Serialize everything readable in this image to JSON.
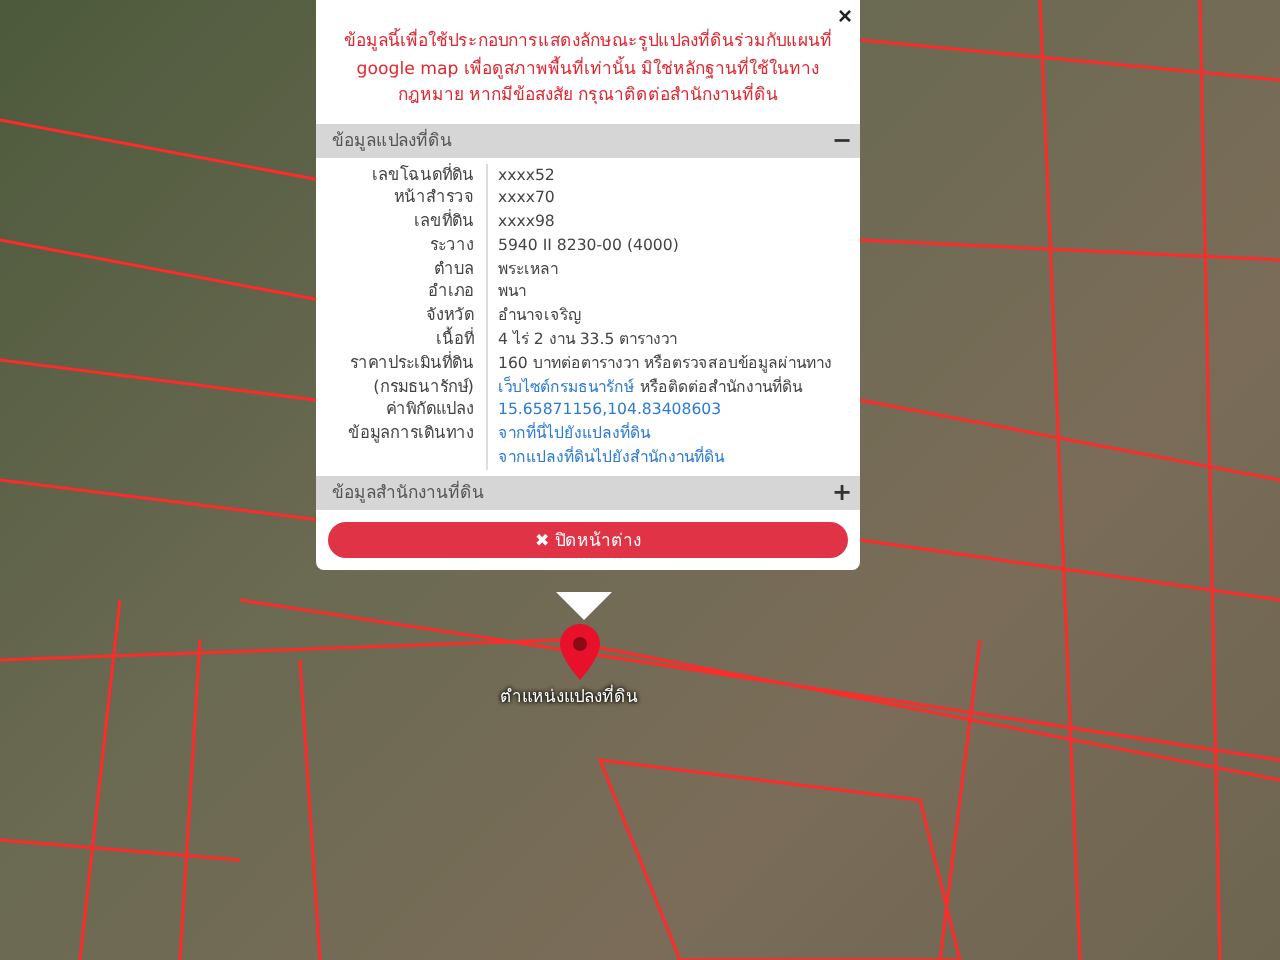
{
  "popup": {
    "notice": "ข้อมูลนี้เพื่อใช้ประกอบการแสดงลักษณะรูปแปลงที่ดินร่วมกับแผนที่ google map เพื่อดูสภาพพื้นที่เท่านั้น มิใช่หลักฐานที่ใช้ในทางกฎหมาย หากมีข้อสงสัย กรุณาติดต่อสำนักงานที่ดิน",
    "close_icon": "×",
    "sections": [
      {
        "title": "ข้อมูลแปลงที่ดิน",
        "toggle": "−",
        "rows": [
          {
            "label": [
              "เลขโฉนดที่ดิน"
            ],
            "lines": [
              [
                {
                  "kind": "text",
                  "text": "xxxx52"
                }
              ]
            ]
          },
          {
            "label": [
              "หน้าสำรวจ"
            ],
            "lines": [
              [
                {
                  "kind": "text",
                  "text": "xxxx70"
                }
              ]
            ]
          },
          {
            "label": [
              "เลขที่ดิน"
            ],
            "lines": [
              [
                {
                  "kind": "text",
                  "text": "xxxx98"
                }
              ]
            ]
          },
          {
            "label": [
              "ระวาง"
            ],
            "lines": [
              [
                {
                  "kind": "text",
                  "text": "5940 II 8230-00 (4000)"
                }
              ]
            ]
          },
          {
            "label": [
              "ตำบล"
            ],
            "lines": [
              [
                {
                  "kind": "text",
                  "text": "พระเหลา"
                }
              ]
            ]
          },
          {
            "label": [
              "อำเภอ"
            ],
            "lines": [
              [
                {
                  "kind": "text",
                  "text": "พนา"
                }
              ]
            ]
          },
          {
            "label": [
              "จังหวัด"
            ],
            "lines": [
              [
                {
                  "kind": "text",
                  "text": "อำนาจเจริญ"
                }
              ]
            ]
          },
          {
            "label": [
              "เนื้อที่"
            ],
            "lines": [
              [
                {
                  "kind": "text",
                  "text": "4 ไร่ 2 งาน 33.5 ตารางวา"
                }
              ]
            ]
          },
          {
            "label": [
              "ราคาประเมินที่ดิน",
              "(กรมธนารักษ์)"
            ],
            "lines": [
              [
                {
                  "kind": "text",
                  "text": "160 บาทต่อตารางวา หรือตรวจสอบข้อมูลผ่านทาง"
                }
              ],
              [
                {
                  "kind": "link",
                  "text": "เว็บไซต์กรมธนารักษ์"
                },
                {
                  "kind": "text",
                  "text": "หรือติดต่อสำนักงานที่ดิน"
                }
              ]
            ]
          },
          {
            "label": [
              "ค่าพิกัดแปลง"
            ],
            "lines": [
              [
                {
                  "kind": "link",
                  "text": "15.65871156,104.83408603"
                }
              ]
            ]
          },
          {
            "label": [
              "ข้อมูลการเดินทาง"
            ],
            "lines": [
              [
                {
                  "kind": "link",
                  "text": "จากที่นี่ไปยังแปลงที่ดิน"
                }
              ],
              [
                {
                  "kind": "link",
                  "text": "จากแปลงที่ดินไปยังสำนักงานที่ดิน"
                }
              ]
            ]
          }
        ]
      },
      {
        "title": "ข้อมูลสำนักงานที่ดิน",
        "toggle": "+"
      }
    ],
    "close_button": {
      "icon": "✖",
      "label": "ปิดหน้าต่าง"
    }
  },
  "map": {
    "marker_label": "ตำแหน่งแปลงที่ดิน"
  }
}
